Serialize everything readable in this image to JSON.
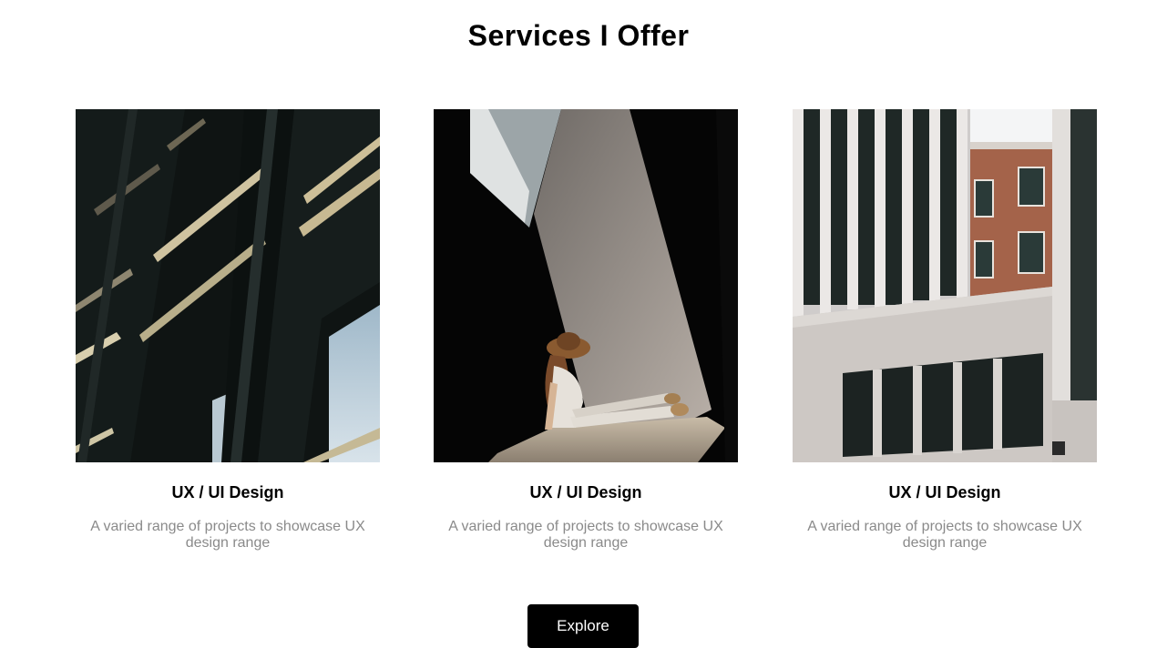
{
  "heading": "Services I Offer",
  "cards": [
    {
      "image": "abstract-dark-architecture-photo",
      "title": "UX / UI Design",
      "description": "A varied range of projects to showcase UX design range"
    },
    {
      "image": "woman-in-sunlight-photo",
      "title": "UX / UI Design",
      "description": "A varied range of projects to showcase UX design range"
    },
    {
      "image": "modern-building-facade-photo",
      "title": "UX / UI Design",
      "description": "A varied range of projects to showcase UX design range"
    }
  ],
  "explore_label": "Explore",
  "colors": {
    "text": "#000000",
    "muted": "#8a8a8a",
    "button_bg": "#000000",
    "button_text": "#ffffff"
  }
}
